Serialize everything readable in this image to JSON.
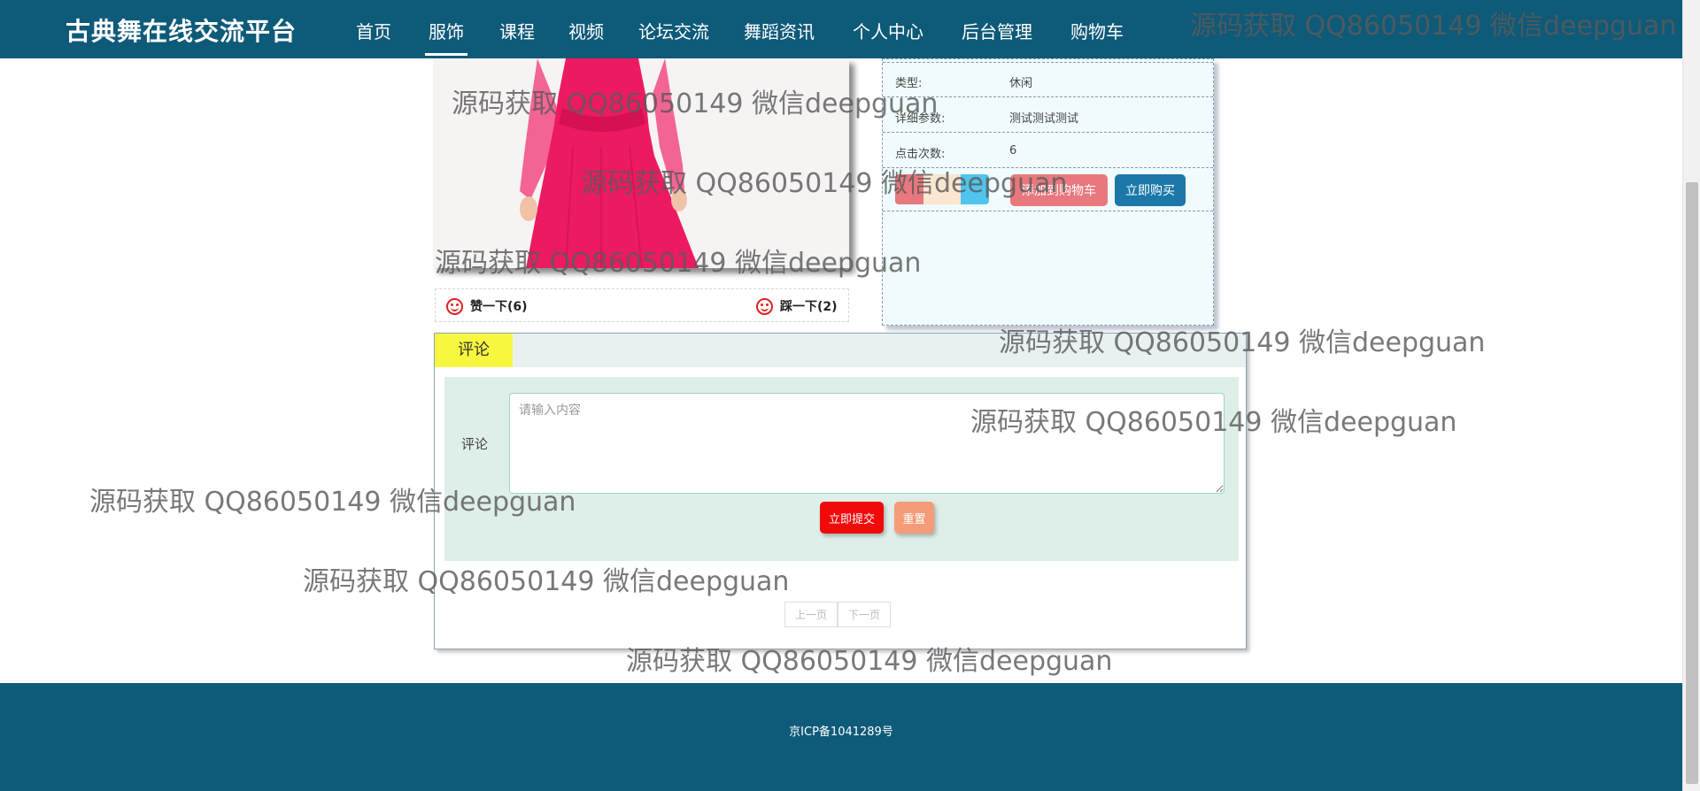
{
  "header": {
    "brand": "古典舞在线交流平台",
    "nav": [
      "首页",
      "服饰",
      "课程",
      "视频",
      "论坛交流",
      "舞蹈资讯",
      "个人中心",
      "后台管理",
      "购物车"
    ],
    "active_index": 1
  },
  "product": {
    "image_icon": "red-dress-photo",
    "info": [
      {
        "label": "类型:",
        "value": "休闲"
      },
      {
        "label": "详细参数:",
        "value": "测试测试测试"
      },
      {
        "label": "点击次数:",
        "value": "6"
      }
    ],
    "add_to_cart_label": "添加到购物车",
    "buy_now_label": "立即购买"
  },
  "votes": {
    "like_label": "赞一下(6)",
    "dislike_label": "踩一下(2)",
    "like_icon": "smile-icon",
    "dislike_icon": "sad-face-icon"
  },
  "comment": {
    "tab_label": "评论",
    "field_label": "评论",
    "placeholder": "请输入内容",
    "submit_label": "立即提交",
    "reset_label": "重置",
    "prev_label": "上一页",
    "next_label": "下一页"
  },
  "footer": {
    "icp": "京ICP备1041289号"
  },
  "watermark": "源码获取 QQ86050149 微信deepguan",
  "colors": {
    "primary": "#0e5a79",
    "comment_tab": "#f7f740",
    "submit": "#f00a0a",
    "reset": "#f49c78",
    "add_to_cart": "#e8787d",
    "buy_now": "#1b78a8"
  }
}
